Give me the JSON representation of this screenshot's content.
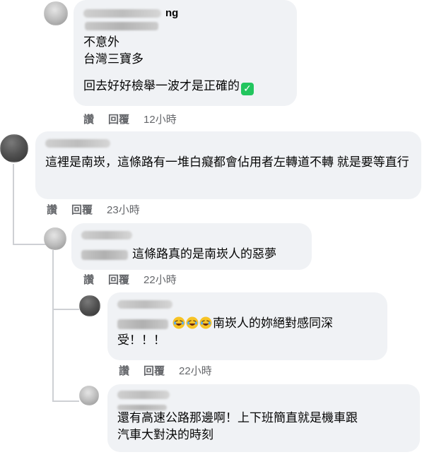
{
  "comments": [
    {
      "id": "c1",
      "author_suffix": "ng",
      "lines": [
        "不意外",
        "台灣三寶多",
        "",
        "回去好好檢舉一波才是正確的"
      ],
      "check_icon": "white-check-mark-icon",
      "actions": {
        "like": "讚",
        "reply": "回覆",
        "time": "12小時"
      }
    },
    {
      "id": "c2",
      "text": "這裡是南崁，這條路有一堆白癡都會佔用者左轉道不轉 就是要等直行",
      "actions": {
        "like": "讚",
        "reply": "回覆",
        "time": "23小時"
      }
    },
    {
      "id": "c3",
      "text": "這條路真的是南崁人的惡夢",
      "actions": {
        "like": "讚",
        "reply": "回覆",
        "time": "22小時"
      }
    },
    {
      "id": "c4",
      "emojis": [
        "rolling-on-floor-laughing-icon",
        "rolling-on-floor-laughing-icon",
        "rolling-on-floor-laughing-icon"
      ],
      "text_line1": "南崁人的妳絕對感同深",
      "text_line2": "受！！！",
      "actions": {
        "like": "讚",
        "reply": "回覆",
        "time": "22小時"
      }
    },
    {
      "id": "c5",
      "text_line1": "還有高速公路那邊啊！上下班簡直就是機車跟",
      "text_line2": "汽車大對決的時刻"
    }
  ],
  "colors": {
    "bubble_bg": "#f0f2f5",
    "meta_text": "#65676b",
    "thread_line": "#ced0d4",
    "check_green": "#22c55e"
  }
}
